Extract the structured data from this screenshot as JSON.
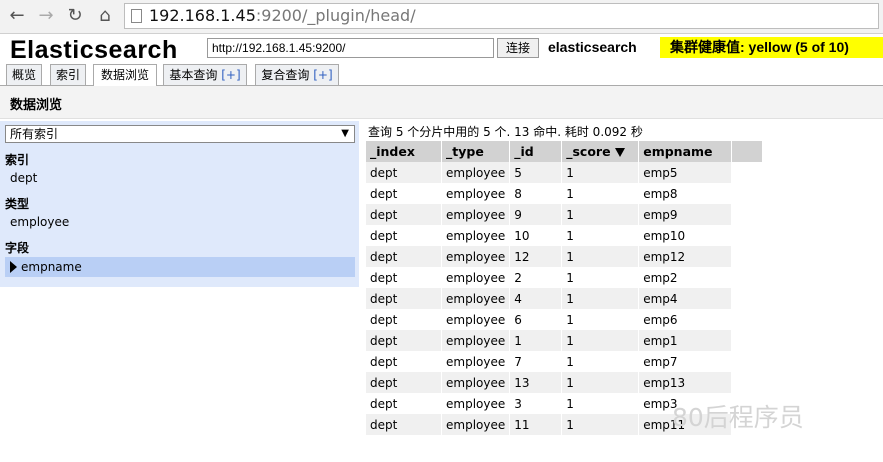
{
  "browser": {
    "url_host": "192.168.1.45",
    "url_rest": ":9200/_plugin/head/"
  },
  "header": {
    "app_title": "Elasticsearch",
    "connection_url": "http://192.168.1.45:9200/",
    "connect_label": "连接",
    "cluster_name": "elasticsearch",
    "health_text": "集群健康值: yellow (5 of 10)",
    "health_color": "#ffff00"
  },
  "tabs": [
    {
      "label": "概览",
      "plus": ""
    },
    {
      "label": "索引",
      "plus": ""
    },
    {
      "label": "数据浏览",
      "plus": ""
    },
    {
      "label": "基本查询",
      "plus": "[+]"
    },
    {
      "label": "复合查询",
      "plus": "[+]"
    }
  ],
  "section_title": "数据浏览",
  "sidebar": {
    "index_select_value": "所有索引",
    "groups": [
      {
        "label": "索引",
        "items": [
          "dept"
        ]
      },
      {
        "label": "类型",
        "items": [
          "employee"
        ]
      },
      {
        "label": "字段",
        "items": [
          "empname"
        ]
      }
    ]
  },
  "results": {
    "summary": "查询 5 个分片中用的 5 个. 13 命中. 耗时 0.092 秒",
    "columns": [
      "_index",
      "_type",
      "_id",
      "_score",
      "empname"
    ],
    "rows": [
      [
        "dept",
        "employee",
        "5",
        "1",
        "emp5"
      ],
      [
        "dept",
        "employee",
        "8",
        "1",
        "emp8"
      ],
      [
        "dept",
        "employee",
        "9",
        "1",
        "emp9"
      ],
      [
        "dept",
        "employee",
        "10",
        "1",
        "emp10"
      ],
      [
        "dept",
        "employee",
        "12",
        "1",
        "emp12"
      ],
      [
        "dept",
        "employee",
        "2",
        "1",
        "emp2"
      ],
      [
        "dept",
        "employee",
        "4",
        "1",
        "emp4"
      ],
      [
        "dept",
        "employee",
        "6",
        "1",
        "emp6"
      ],
      [
        "dept",
        "employee",
        "1",
        "1",
        "emp1"
      ],
      [
        "dept",
        "employee",
        "7",
        "1",
        "emp7"
      ],
      [
        "dept",
        "employee",
        "13",
        "1",
        "emp13"
      ],
      [
        "dept",
        "employee",
        "3",
        "1",
        "emp3"
      ],
      [
        "dept",
        "employee",
        "11",
        "1",
        "emp11"
      ]
    ]
  },
  "watermark": "80后程序员"
}
